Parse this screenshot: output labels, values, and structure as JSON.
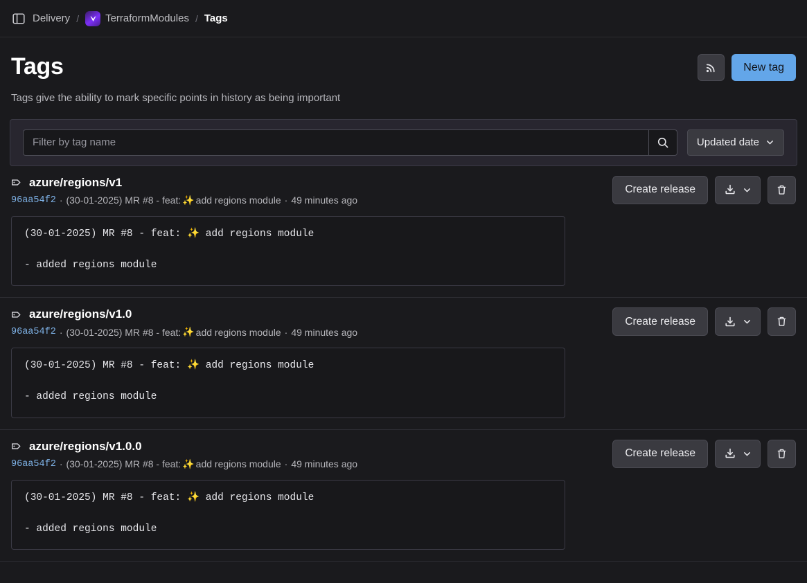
{
  "breadcrumb": {
    "sidebar_toggle_icon": "sidebar-toggle-icon",
    "group": "Delivery",
    "separator": "/",
    "project": "TerraformModules",
    "current": "Tags"
  },
  "header": {
    "title": "Tags",
    "description": "Tags give the ability to mark specific points in history as being important",
    "rss_icon": "rss-feed-icon",
    "new_tag_label": "New tag"
  },
  "filter": {
    "placeholder": "Filter by tag name",
    "value": "",
    "search_icon": "search-icon",
    "sort_label": "Updated date",
    "sort_chevron_icon": "chevron-down-icon"
  },
  "row_actions": {
    "create_release_label": "Create release",
    "download_icon": "download-icon",
    "download_chevron_icon": "chevron-down-icon",
    "delete_icon": "trash-icon"
  },
  "tags": [
    {
      "name": "azure/regions/v1",
      "tag_icon": "tag-icon",
      "sha": "96aa54f2",
      "message": "(30-01-2025) MR #8 - feat:",
      "emoji": "✨",
      "message_tail": "add regions module",
      "time": "49 minutes ago",
      "release_notes": "(30-01-2025) MR #8 - feat: ✨ add regions module\n\n- added regions module"
    },
    {
      "name": "azure/regions/v1.0",
      "tag_icon": "tag-icon",
      "sha": "96aa54f2",
      "message": "(30-01-2025) MR #8 - feat:",
      "emoji": "✨",
      "message_tail": "add regions module",
      "time": "49 minutes ago",
      "release_notes": "(30-01-2025) MR #8 - feat: ✨ add regions module\n\n- added regions module"
    },
    {
      "name": "azure/regions/v1.0.0",
      "tag_icon": "tag-icon",
      "sha": "96aa54f2",
      "message": "(30-01-2025) MR #8 - feat:",
      "emoji": "✨",
      "message_tail": "add regions module",
      "time": "49 minutes ago",
      "release_notes": "(30-01-2025) MR #8 - feat: ✨ add regions module\n\n- added regions module"
    }
  ],
  "colors": {
    "page_bg": "#1a1a1d",
    "panel_bg": "#28262f",
    "code_bg": "#18181b",
    "accent": "#63a6e9",
    "link": "#7fb3e8",
    "button_bg": "#3a3a40"
  }
}
